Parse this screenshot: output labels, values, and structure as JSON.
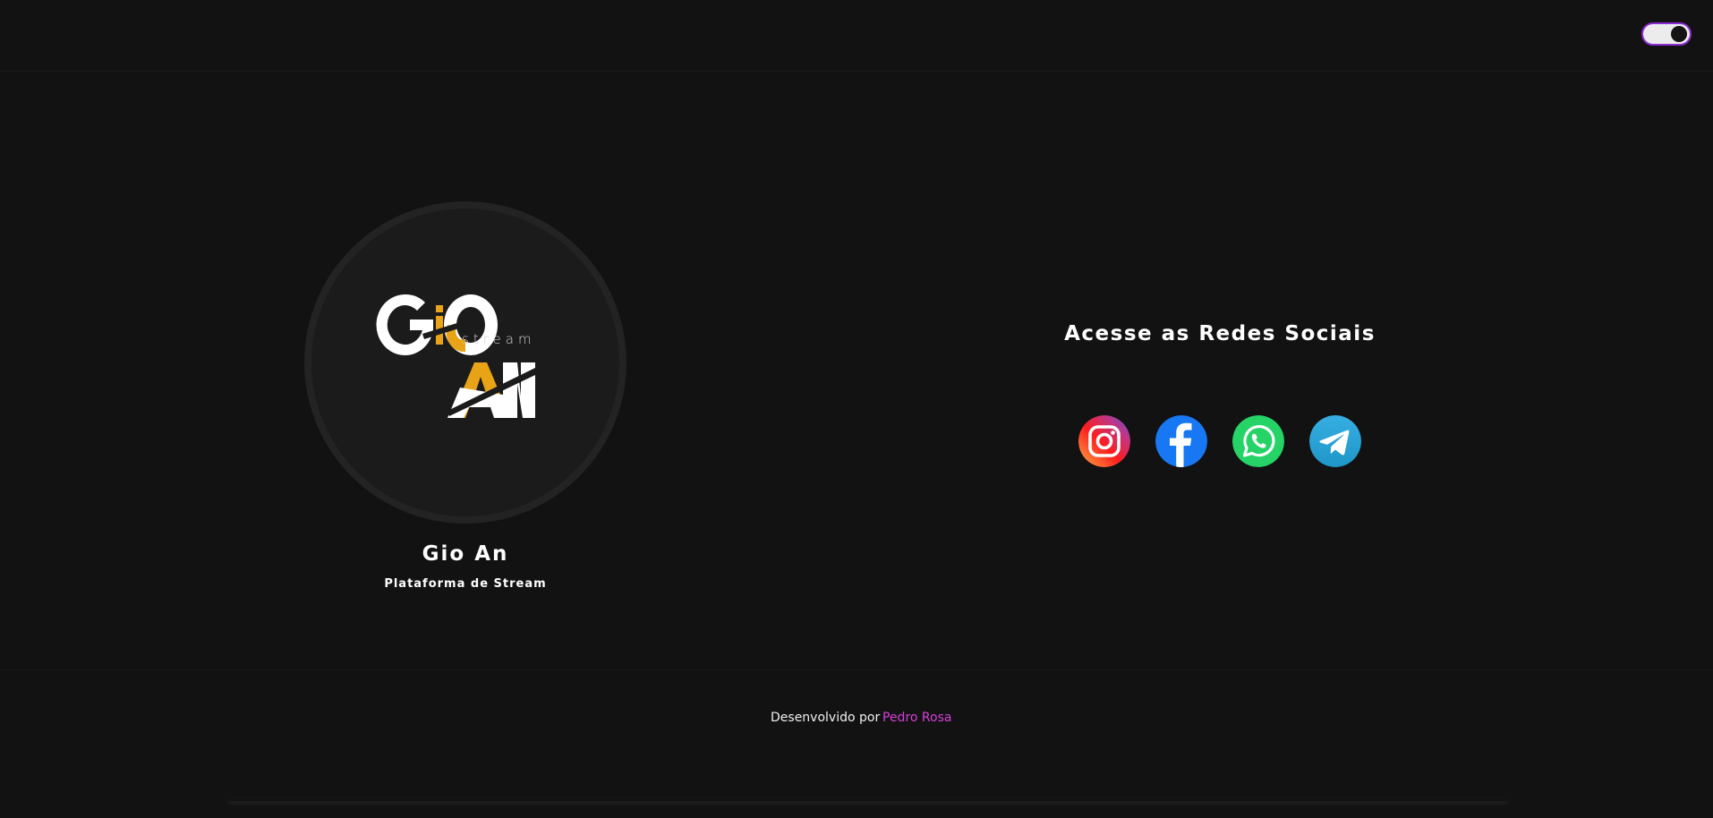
{
  "header": {
    "theme_toggle": {
      "state": "dark",
      "accent_color": "#8b2bd1"
    }
  },
  "profile": {
    "logo": {
      "text": "GIO AN",
      "caption": "stream",
      "colors": [
        "#ffffff",
        "#e8a317"
      ]
    },
    "name": "Gio An",
    "subtitle": "Plataforma de Stream"
  },
  "social": {
    "title": "Acesse as Redes Sociais",
    "links": [
      {
        "icon": "instagram-icon"
      },
      {
        "icon": "facebook-icon",
        "color": "#1877f2"
      },
      {
        "icon": "whatsapp-icon",
        "color": "#25d366"
      },
      {
        "icon": "telegram-icon",
        "color": "#2aa3de"
      }
    ]
  },
  "footer": {
    "text": "Desenvolvido por",
    "author": "Pedro Rosa",
    "author_color": "#d63fd9"
  }
}
